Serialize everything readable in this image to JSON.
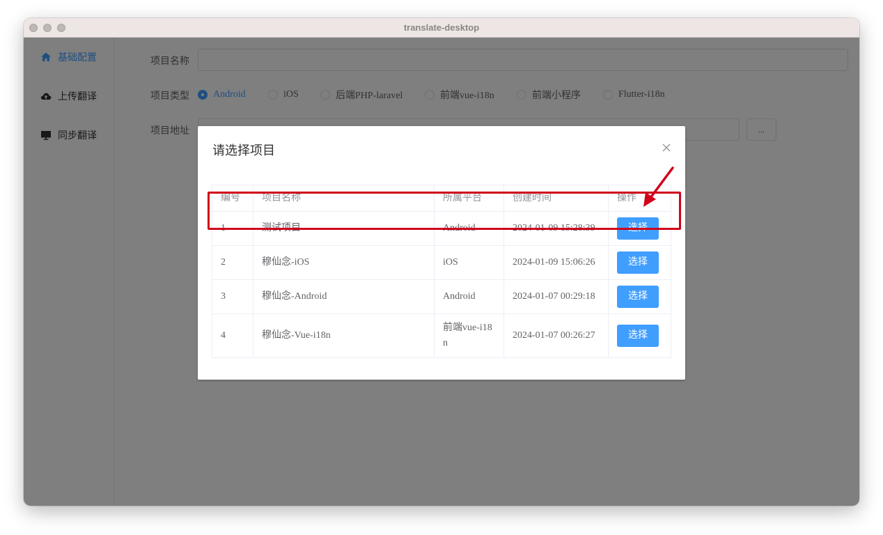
{
  "window": {
    "title": "translate-desktop"
  },
  "sidebar": {
    "items": [
      {
        "label": "基础配置",
        "icon": "home-icon",
        "active": true
      },
      {
        "label": "上传翻译",
        "icon": "cloud-upload-icon",
        "active": false
      },
      {
        "label": "同步翻译",
        "icon": "monitor-icon",
        "active": false
      }
    ]
  },
  "form": {
    "name_label": "项目名称",
    "name_value": "",
    "type_label": "项目类型",
    "type_options": [
      "Android",
      "iOS",
      "后端PHP-laravel",
      "前端vue-i18n",
      "前端小程序",
      "Flutter-i18n"
    ],
    "type_selected": "Android",
    "path_label": "项目地址",
    "path_value": "",
    "browse_label": "..."
  },
  "dialog": {
    "title": "请选择项目",
    "columns": [
      "编号",
      "项目名称",
      "所属平台",
      "创建时间",
      "操作"
    ],
    "rows": [
      {
        "id": "1",
        "name": "测试项目",
        "platform": "Android",
        "created": "2024-01-09 15:28:39",
        "action": "选择"
      },
      {
        "id": "2",
        "name": "穆仙念-iOS",
        "platform": "iOS",
        "created": "2024-01-09 15:06:26",
        "action": "选择"
      },
      {
        "id": "3",
        "name": "穆仙念-Android",
        "platform": "Android",
        "created": "2024-01-07 00:29:18",
        "action": "选择"
      },
      {
        "id": "4",
        "name": "穆仙念-Vue-i18n",
        "platform": "前端vue-i18n",
        "created": "2024-01-07 00:26:27",
        "action": "选择"
      }
    ]
  },
  "colors": {
    "accent": "#409eff",
    "annotation": "#d0021b"
  }
}
